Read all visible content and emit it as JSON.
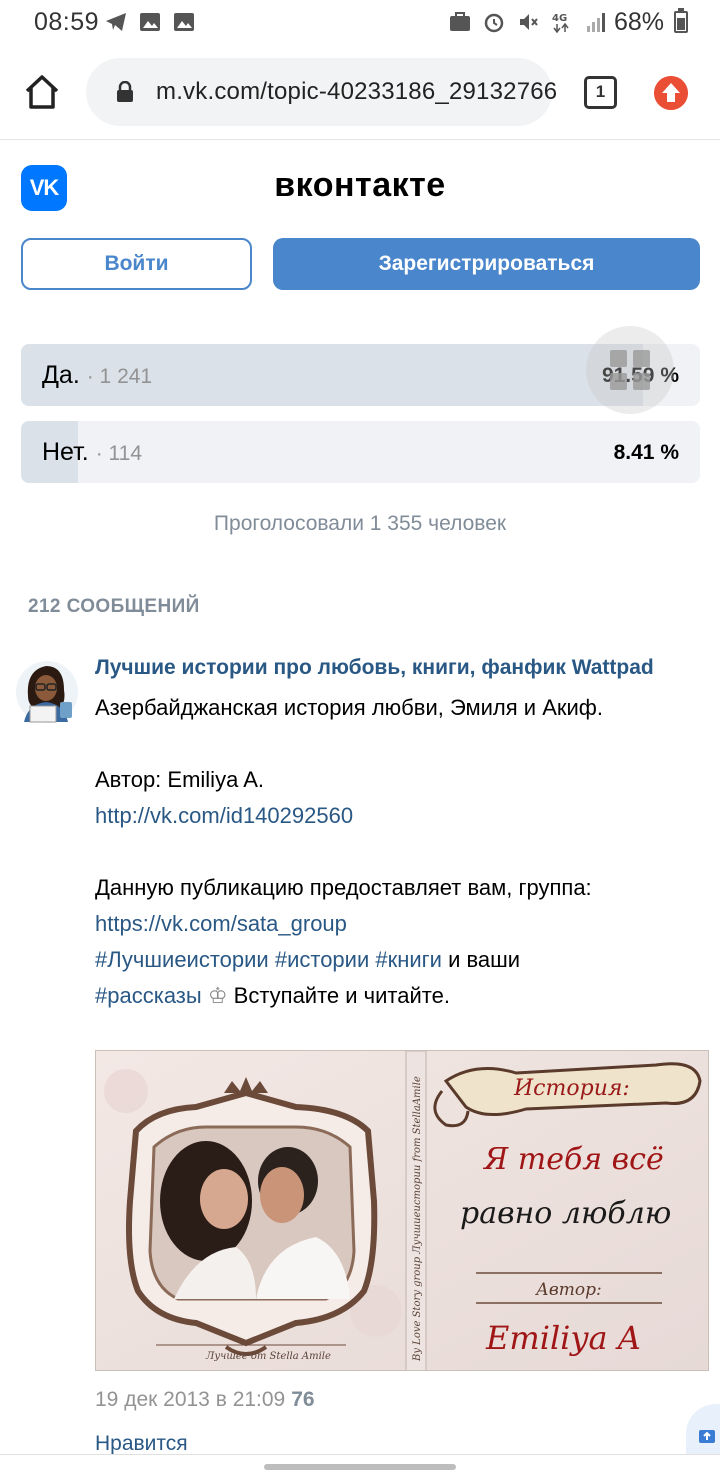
{
  "status_bar": {
    "time": "08:59",
    "battery": "68%",
    "network": "4G"
  },
  "browser": {
    "url": "m.vk.com/topic-40233186_29132766",
    "tab_count": "1"
  },
  "header": {
    "logo_text": "VK",
    "title": "вконтакте",
    "login_label": "Войти",
    "register_label": "Зарегистрироваться"
  },
  "poll": {
    "options": [
      {
        "label": "Да.",
        "count": "· 1 241",
        "percent": "91.59 %",
        "fraction": 0.9159
      },
      {
        "label": "Нет.",
        "count": "· 114",
        "percent": "8.41 %",
        "fraction": 0.0841
      }
    ],
    "total": "Проголосовали 1 355 человек"
  },
  "messages": {
    "header": "212 СООБЩЕНИЙ"
  },
  "post": {
    "author": "Лучшие истории про любовь, книги, фанфик Wattpad",
    "lines": {
      "l1": "Азербайджанская история любви, Эмиля и Акиф.",
      "l2": "Автор: Emiliya A.",
      "l3": "http://vk.com/id140292560",
      "l4": "Данную публикацию предоставляет вам, группа:",
      "l5": "https://vk.com/sata_group",
      "l6_tags": "#Лучшиеистории #истории #книги",
      "l6_text": " и ваши",
      "l7_tag": "#рассказы",
      "l7_emoji": " ♔ ",
      "l7_text": "Вступайте и читайте."
    },
    "image": {
      "banner": "История:",
      "title_line1": "Я тебя всё",
      "title_line2": "равно люблю",
      "author_label": "Автор:",
      "author_name": "Emiliya A",
      "spine_text": "By Love Story group   Лучшиеистории from StellaAmile",
      "footer_text": "Лучшее от Stella Amile"
    },
    "date": "19 дек 2013 в 21:09",
    "views": "76",
    "like_label": "Нравится"
  },
  "colors": {
    "vk_blue": "#4986cc",
    "link": "#2a5885",
    "poll_fill": "#dae1e8"
  }
}
